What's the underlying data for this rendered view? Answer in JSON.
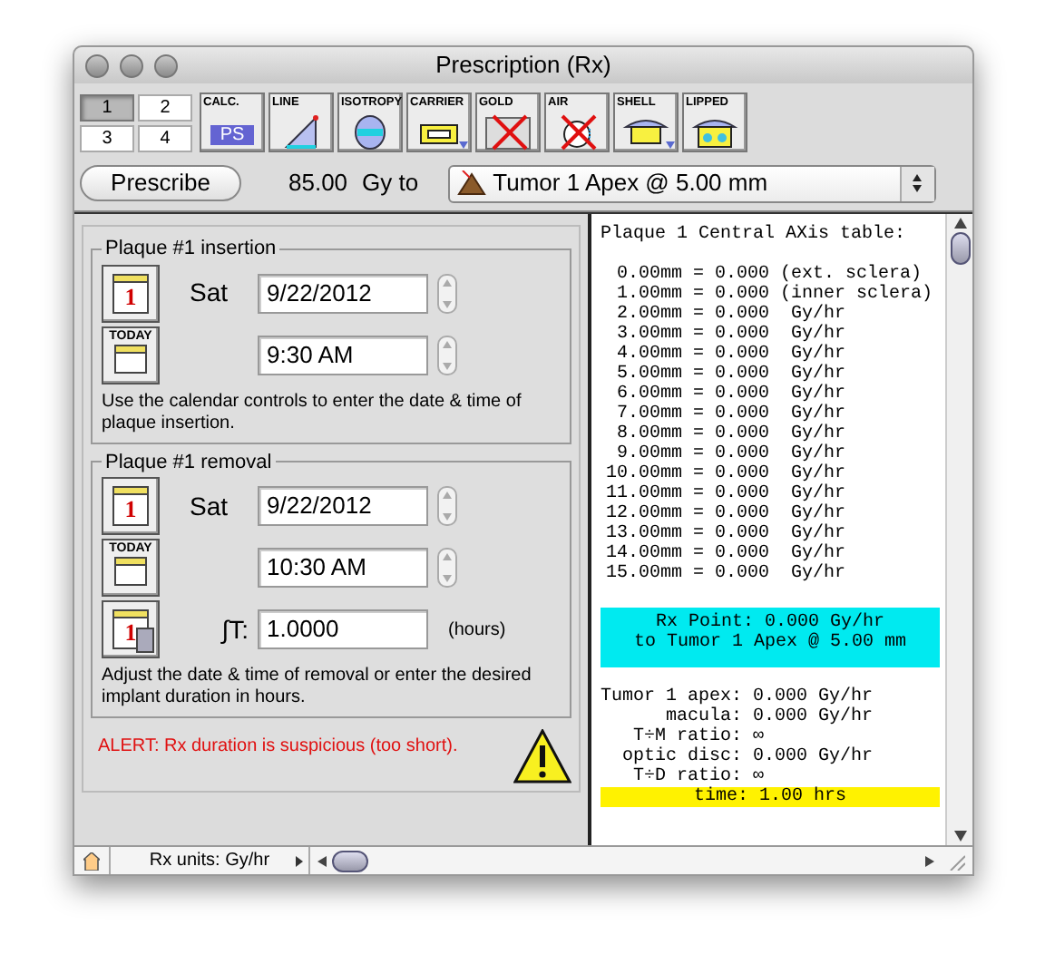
{
  "window": {
    "title": "Prescription (Rx)"
  },
  "layout_tabs": [
    {
      "label": "1",
      "selected": true
    },
    {
      "label": "2",
      "selected": false
    },
    {
      "label": "3",
      "selected": false
    },
    {
      "label": "4",
      "selected": false
    }
  ],
  "tools": [
    {
      "kind": "calc",
      "label": "CALC.",
      "text": "PS",
      "crossed": false,
      "menu": false
    },
    {
      "kind": "line",
      "label": "LINE",
      "crossed": false,
      "menu": false
    },
    {
      "kind": "isotropy",
      "label": "ISOTROPY",
      "crossed": false,
      "menu": false
    },
    {
      "kind": "carrier",
      "label": "CARRIER",
      "crossed": false,
      "menu": true
    },
    {
      "kind": "gold",
      "label": "GOLD",
      "crossed": true,
      "menu": false
    },
    {
      "kind": "air",
      "label": "AIR",
      "crossed": true,
      "menu": false
    },
    {
      "kind": "shell",
      "label": "SHELL",
      "crossed": false,
      "menu": true
    },
    {
      "kind": "lipped",
      "label": "LIPPED",
      "crossed": false,
      "menu": false
    }
  ],
  "prescription": {
    "button": "Prescribe",
    "dose": "85.00",
    "unit": "Gy to",
    "target": "Tumor 1 Apex @ 5.00 mm"
  },
  "insertion": {
    "legend": "Plaque #1 insertion",
    "calendar_day": "1",
    "today_label": "TODAY",
    "weekday": "Sat",
    "date": "9/22/2012",
    "time": "9:30 AM",
    "hint": "Use the calendar controls to enter the date & time of plaque insertion."
  },
  "removal": {
    "legend": "Plaque #1 removal",
    "calendar_day": "1",
    "today_label": "TODAY",
    "weekday": "Sat",
    "date": "9/22/2012",
    "time": "10:30 AM",
    "calculator_day": "1",
    "duration_label": "∫T:",
    "duration": "1.0000",
    "duration_unit": "(hours)",
    "hint": "Adjust the date & time of removal or enter the desired implant duration in hours."
  },
  "alert": "ALERT: Rx duration is suspicious (too short).",
  "table": {
    "title": "Plaque 1 Central AXis table:",
    "rows": [
      " 0.00mm = 0.000 (ext. sclera)",
      " 1.00mm = 0.000 (inner sclera)",
      " 2.00mm = 0.000  Gy/hr",
      " 3.00mm = 0.000  Gy/hr",
      " 4.00mm = 0.000  Gy/hr",
      " 5.00mm = 0.000  Gy/hr",
      " 6.00mm = 0.000  Gy/hr",
      " 7.00mm = 0.000  Gy/hr",
      " 8.00mm = 0.000  Gy/hr",
      " 9.00mm = 0.000  Gy/hr",
      "10.00mm = 0.000  Gy/hr",
      "11.00mm = 0.000  Gy/hr",
      "12.00mm = 0.000  Gy/hr",
      "13.00mm = 0.000  Gy/hr",
      "14.00mm = 0.000  Gy/hr",
      "15.00mm = 0.000  Gy/hr"
    ],
    "rx_point": [
      "Rx Point: 0.000 Gy/hr",
      "to Tumor 1 Apex @ 5.00 mm"
    ],
    "summary": [
      "Tumor 1 apex: 0.000 Gy/hr",
      "      macula: 0.000 Gy/hr",
      "   T÷M ratio: ∞",
      "  optic disc: 0.000 Gy/hr",
      "   T÷D ratio: ∞"
    ],
    "time": "time: 1.00 hrs"
  },
  "status_bar": {
    "units": "Rx units: Gy/hr"
  }
}
